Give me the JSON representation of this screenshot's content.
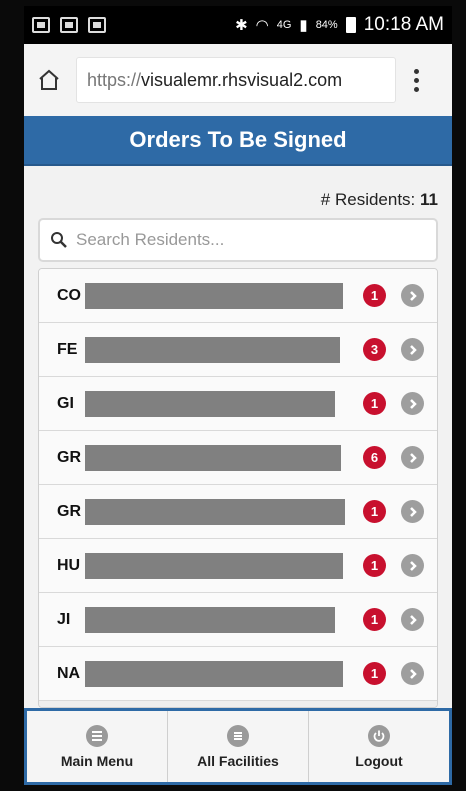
{
  "status_bar": {
    "left_icons": [
      "gallery-icon",
      "image-icon",
      "mail-icon"
    ],
    "network": "4G",
    "battery": "84%",
    "time": "10:18 AM"
  },
  "browser": {
    "url_scheme": "https://",
    "url_host": "visualemr.rhsvisual2.com"
  },
  "header": {
    "title": "Orders To Be Signed"
  },
  "residents": {
    "label": "# Residents:",
    "count": "11"
  },
  "search": {
    "placeholder": "Search Residents..."
  },
  "rows": [
    {
      "name": "CO",
      "badge": "1"
    },
    {
      "name": "FE",
      "badge": "3"
    },
    {
      "name": "GI",
      "badge": "1"
    },
    {
      "name": "GR",
      "badge": "6"
    },
    {
      "name": "GR",
      "badge": "1"
    },
    {
      "name": "HU",
      "badge": "1"
    },
    {
      "name": "JI",
      "badge": "1"
    },
    {
      "name": "NA",
      "badge": "1"
    }
  ],
  "bottom_nav": [
    {
      "label": "Main Menu",
      "icon": "list-icon"
    },
    {
      "label": "All Facilities",
      "icon": "menu-icon"
    },
    {
      "label": "Logout",
      "icon": "power-icon"
    }
  ],
  "colors": {
    "brand_blue": "#2e6aa6",
    "badge_red": "#c8102e",
    "redaction_gray": "#808080"
  }
}
